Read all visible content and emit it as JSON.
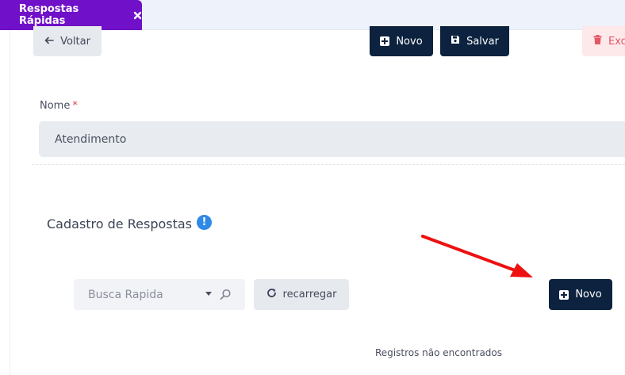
{
  "tabs": [
    {
      "label": "Respostas Rápidas",
      "active": true
    }
  ],
  "toolbar": {
    "back_label": "Voltar",
    "new_label": "Novo",
    "save_label": "Salvar",
    "delete_label": "Exc"
  },
  "form": {
    "name_label": "Nome",
    "name_required_mark": "*",
    "name_value": "Atendimento"
  },
  "section": {
    "title": "Cadastro de Respostas",
    "info_glyph": "!"
  },
  "list": {
    "search_placeholder": "Busca Rapida",
    "reload_label": "recarregar",
    "new_label": "Novo",
    "empty_message": "Registros não encontrados"
  },
  "colors": {
    "tab_active": "#7010c8",
    "primary_dark": "#0c223f",
    "danger_light": "#fde8ea",
    "danger_text": "#e35765",
    "info": "#2e8ae6",
    "annotation_arrow": "#ee1111"
  },
  "icons": {
    "tab_close": "close-icon",
    "back": "arrow-left-icon",
    "new": "plus-square-icon",
    "save": "floppy-disk-icon",
    "delete": "trash-icon",
    "info": "exclamation-circle-icon",
    "dropdown": "caret-down-icon",
    "search": "search-icon",
    "reload": "refresh-icon"
  }
}
